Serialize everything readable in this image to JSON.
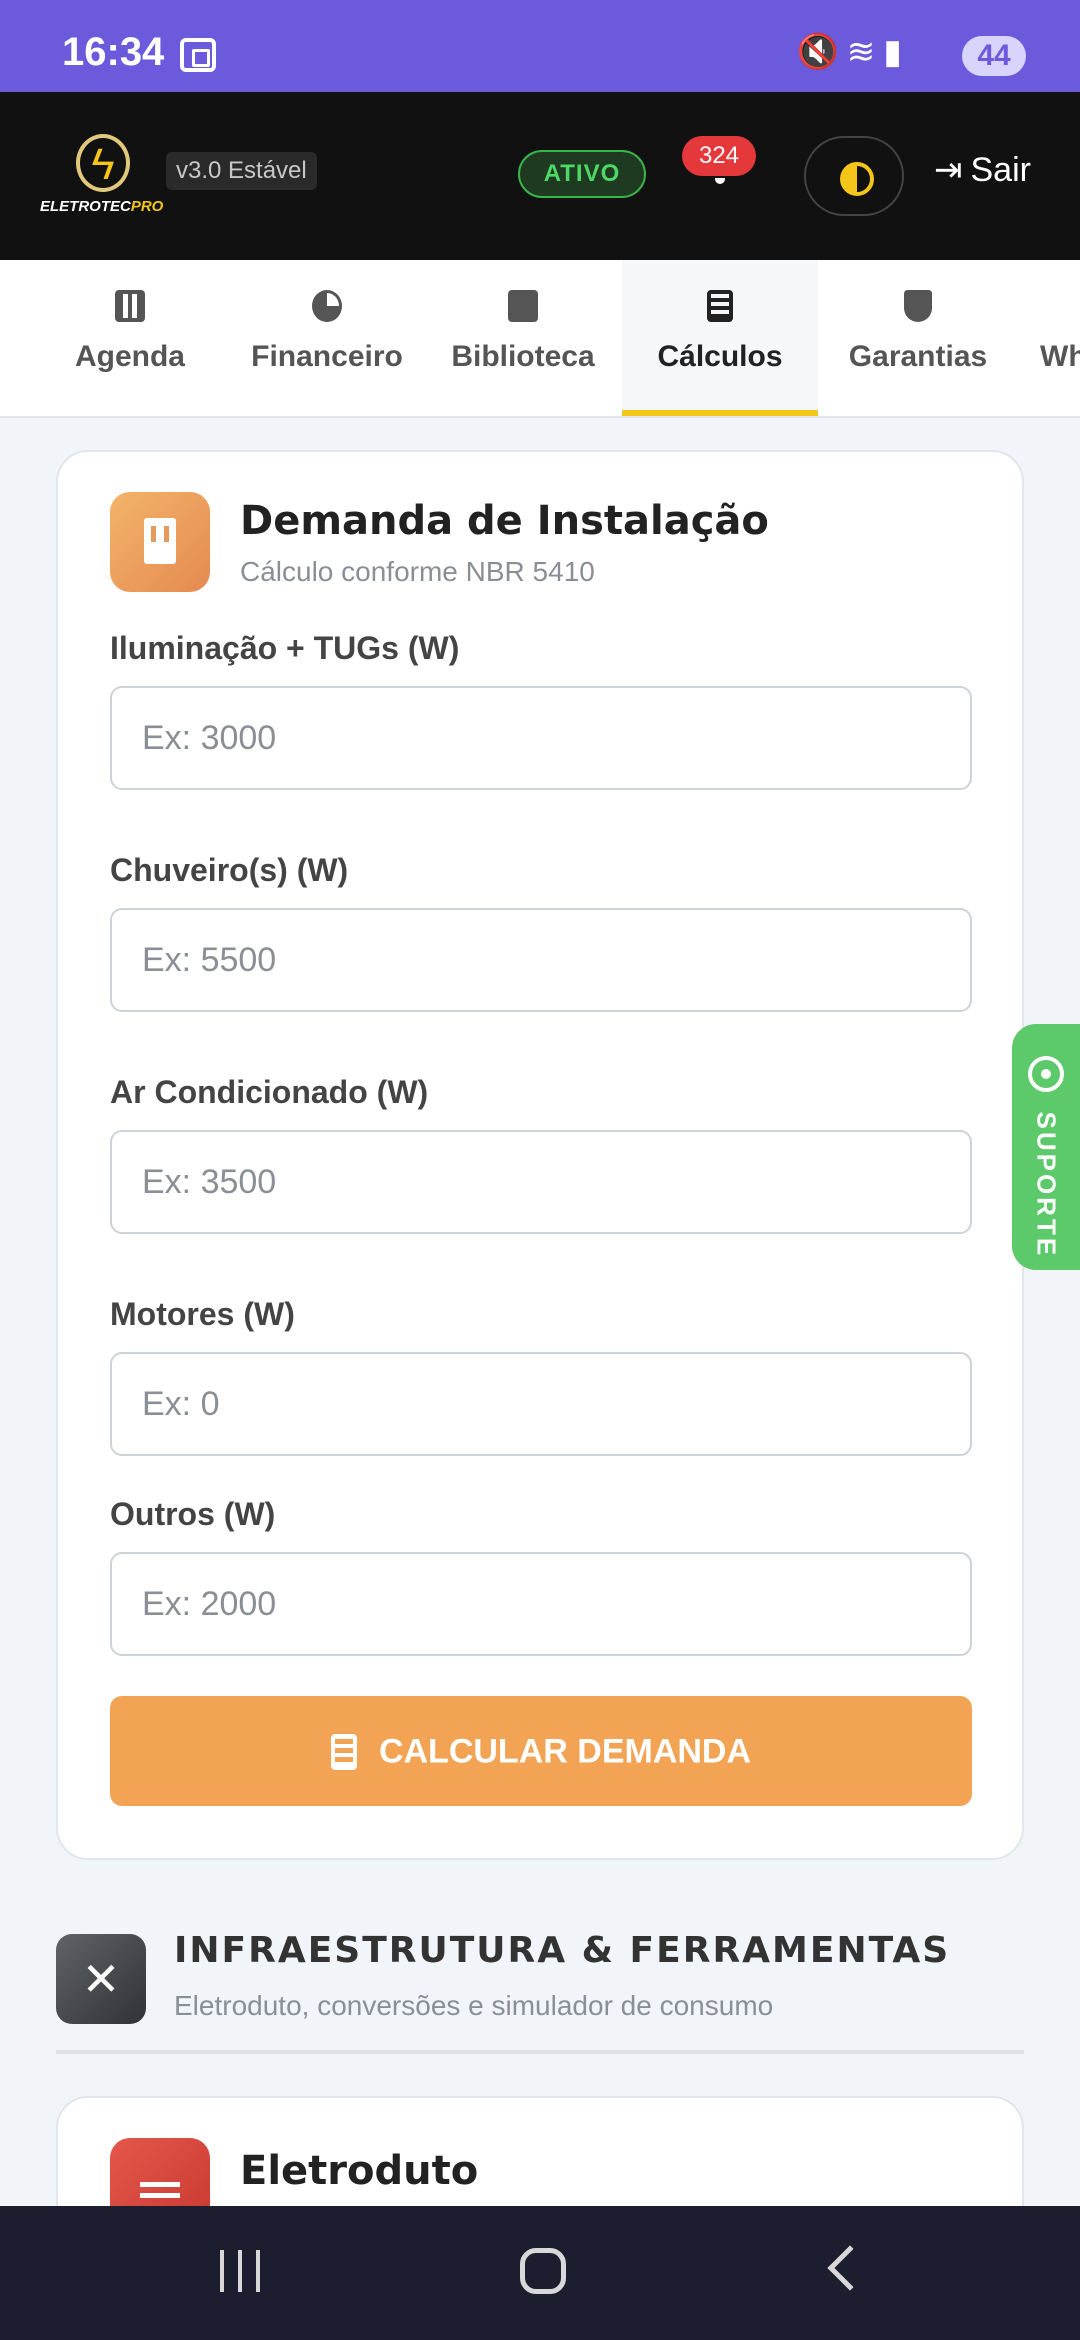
{
  "status_bar": {
    "time": "16:34",
    "battery": "44",
    "icons": [
      "screenshot-icon",
      "mute-icon",
      "wifi-icon",
      "signal-icon"
    ]
  },
  "header": {
    "brand_main": "ELETROTEC",
    "brand_accent": "PRO",
    "version": "v3.0 Estável",
    "status": "ATIVO",
    "notifications": "324",
    "logout_label": "Sair",
    "colors": {
      "background": "#111111",
      "accent": "#f5c518",
      "status_green": "#4cd964",
      "badge_red": "#e5383b"
    }
  },
  "tabs": [
    {
      "label": "Agenda",
      "icon": "calendar-icon"
    },
    {
      "label": "Financeiro",
      "icon": "pie-chart-icon"
    },
    {
      "label": "Biblioteca",
      "icon": "book-icon"
    },
    {
      "label": "Cálculos",
      "icon": "calculator-icon",
      "active": true
    },
    {
      "label": "Garantias",
      "icon": "shield-icon"
    },
    {
      "label": "Wh",
      "icon": "whatsapp-icon"
    }
  ],
  "demand_card": {
    "title": "Demanda de Instalação",
    "subtitle": "Cálculo conforme NBR 5410",
    "icon": "building-icon",
    "fields": [
      {
        "label": "Iluminação + TUGs (W)",
        "placeholder": "Ex: 3000",
        "value": ""
      },
      {
        "label": "Chuveiro(s) (W)",
        "placeholder": "Ex: 5500",
        "value": ""
      },
      {
        "label": "Ar Condicionado (W)",
        "placeholder": "Ex: 3500",
        "value": ""
      },
      {
        "label": "Motores (W)",
        "placeholder": "Ex: 0",
        "value": ""
      },
      {
        "label": "Outros (W)",
        "placeholder": "Ex: 2000",
        "value": ""
      }
    ],
    "button_label": "CALCULAR DEMANDA",
    "button_color": "#f2a354"
  },
  "section": {
    "title": "INFRAESTRUTURA & FERRAMENTAS",
    "subtitle": "Eletroduto, conversões e simulador de consumo",
    "icon": "tools-icon"
  },
  "next_card": {
    "title": "Eletroduto",
    "icon": "conduit-icon"
  },
  "support": {
    "label": "SUPORTE",
    "icon": "whatsapp-icon",
    "color": "#5cc96a"
  },
  "nav": {
    "icons": [
      "recents-icon",
      "home-icon",
      "back-icon"
    ]
  }
}
